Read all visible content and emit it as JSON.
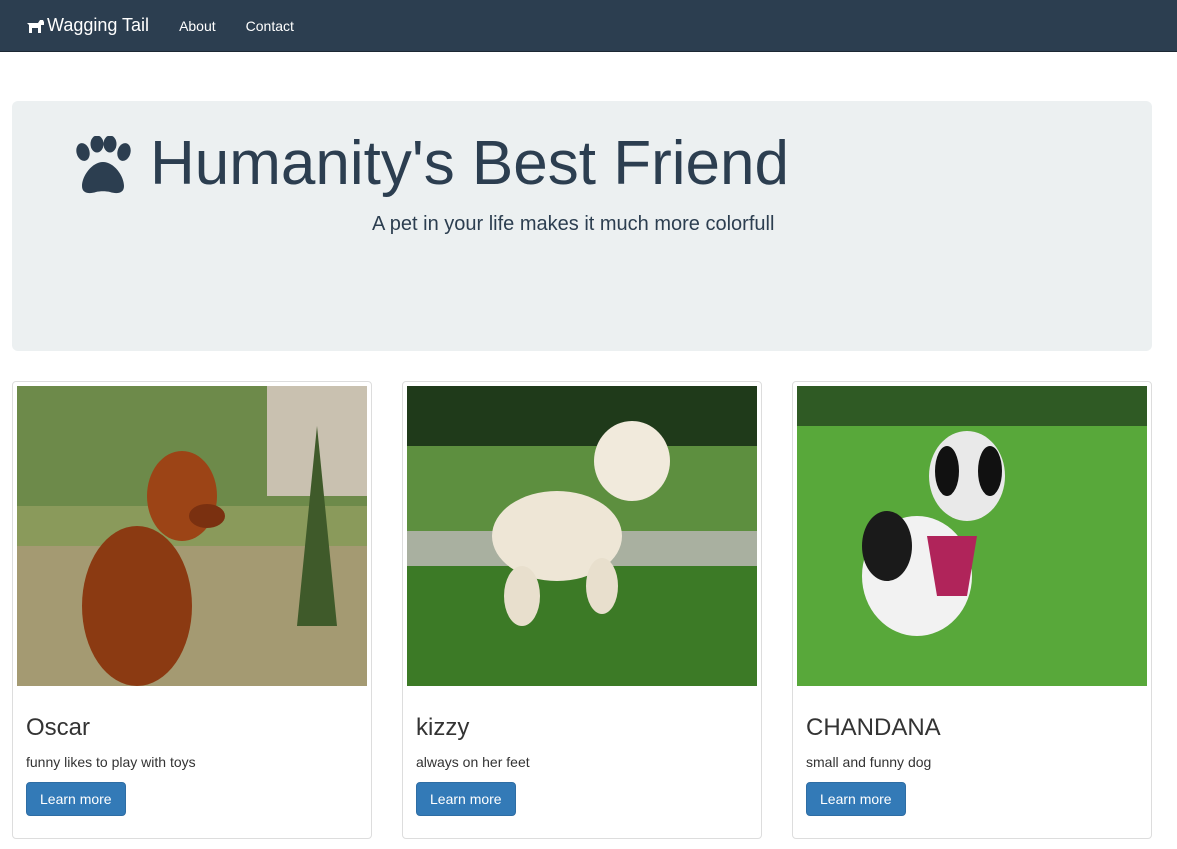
{
  "navbar": {
    "brand": "Wagging Tail",
    "brand_icon": "dog-icon",
    "links": [
      "About",
      "Contact"
    ],
    "bg_color": "#2c3e50"
  },
  "jumbotron": {
    "icon": "paw-icon",
    "title": "Humanity's Best Friend",
    "subtitle": "A pet in your life makes it much more colorfull",
    "bg_color": "#ecf0f1"
  },
  "cards": [
    {
      "name": "Oscar",
      "description": "funny likes to play with toys",
      "button": "Learn more"
    },
    {
      "name": "kizzy",
      "description": "always on her feet",
      "button": "Learn more"
    },
    {
      "name": "CHANDANA",
      "description": "small and funny dog",
      "button": "Learn more"
    }
  ],
  "colors": {
    "button": "#337ab7"
  }
}
